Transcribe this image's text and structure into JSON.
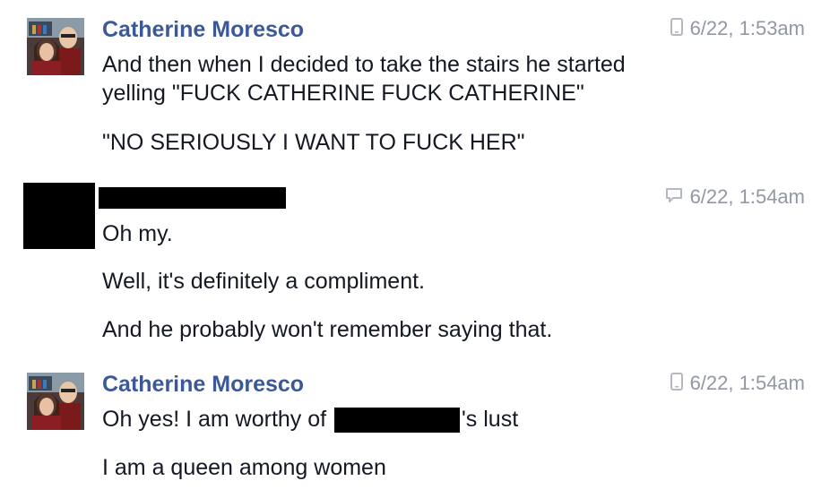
{
  "messages": [
    {
      "sender": "Catherine Moresco",
      "timestamp": "6/22, 1:53am",
      "device_icon": "mobile-phone-icon",
      "lines": [
        "And then when I decided to take the stairs he started",
        "yelling \"FUCK CATHERINE FUCK CATHERINE\"",
        "\"NO SERIOUSLY I WANT TO FUCK HER\""
      ]
    },
    {
      "sender": "",
      "timestamp": "6/22, 1:54am",
      "device_icon": "chat-bubble-icon",
      "lines": [
        "Oh my.",
        "Well, it's definitely a compliment.",
        "And he probably won't remember saying that."
      ]
    },
    {
      "sender": "Catherine Moresco",
      "timestamp": "6/22, 1:54am",
      "device_icon": "mobile-phone-icon",
      "line1_before": "Oh yes! I am worthy of ",
      "line1_after": "'s lust",
      "lines": [
        "I am a queen among women"
      ]
    }
  ],
  "colors": {
    "name": "#3b5998",
    "text": "#141823",
    "timestamp": "#9197a3"
  }
}
